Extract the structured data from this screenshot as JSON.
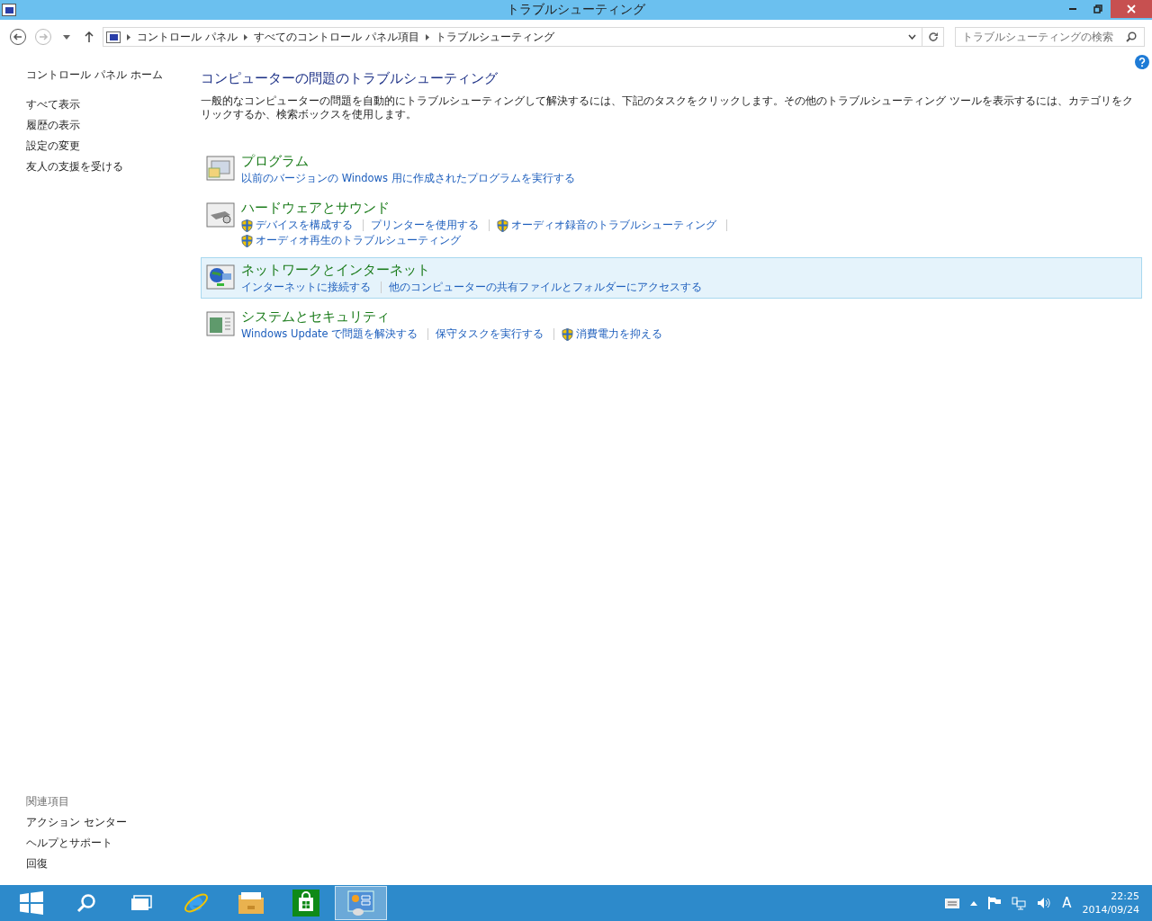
{
  "window": {
    "title": "トラブルシューティング"
  },
  "address_bar": {
    "breadcrumbs": [
      "コントロール パネル",
      "すべてのコントロール パネル項目",
      "トラブルシューティング"
    ]
  },
  "search": {
    "placeholder": "トラブルシューティングの検索"
  },
  "sidebar": {
    "home": "コントロール パネル ホーム",
    "items": [
      "すべて表示",
      "履歴の表示",
      "設定の変更",
      "友人の支援を受ける"
    ],
    "related_heading": "関連項目",
    "related": [
      "アクション センター",
      "ヘルプとサポート",
      "回復"
    ]
  },
  "main": {
    "title": "コンピューターの問題のトラブルシューティング",
    "description": "一般的なコンピューターの問題を自動的にトラブルシューティングして解決するには、下記のタスクをクリックします。その他のトラブルシューティング ツールを表示するには、カテゴリをクリックするか、検索ボックスを使用します。",
    "categories": [
      {
        "kind": "programs",
        "title": "プログラム",
        "highlighted": false,
        "links": [
          {
            "label": "以前のバージョンの Windows 用に作成されたプログラムを実行する",
            "shield": false
          }
        ]
      },
      {
        "kind": "hardware",
        "title": "ハードウェアとサウンド",
        "highlighted": false,
        "links": [
          {
            "label": "デバイスを構成する",
            "shield": true
          },
          {
            "label": "プリンターを使用する",
            "shield": false
          },
          {
            "label": "オーディオ録音のトラブルシューティング",
            "shield": true
          },
          {
            "label": "オーディオ再生のトラブルシューティング",
            "shield": true
          }
        ]
      },
      {
        "kind": "network",
        "title": "ネットワークとインターネット",
        "highlighted": true,
        "links": [
          {
            "label": "インターネットに接続する",
            "shield": false
          },
          {
            "label": "他のコンピューターの共有ファイルとフォルダーにアクセスする",
            "shield": false
          }
        ]
      },
      {
        "kind": "system",
        "title": "システムとセキュリティ",
        "highlighted": false,
        "links": [
          {
            "label": "Windows Update で問題を解決する",
            "shield": false
          },
          {
            "label": "保守タスクを実行する",
            "shield": false
          },
          {
            "label": "消費電力を抑える",
            "shield": true
          }
        ]
      }
    ]
  },
  "taskbar": {
    "items": [
      {
        "kind": "start",
        "selected": false
      },
      {
        "kind": "search",
        "selected": false
      },
      {
        "kind": "taskview",
        "selected": false
      },
      {
        "kind": "browser",
        "selected": false
      },
      {
        "kind": "explorer",
        "selected": false
      },
      {
        "kind": "store",
        "selected": false
      },
      {
        "kind": "controlpanel",
        "selected": true
      }
    ],
    "ime": "A",
    "time": "22:25",
    "date": "2014/09/24"
  }
}
